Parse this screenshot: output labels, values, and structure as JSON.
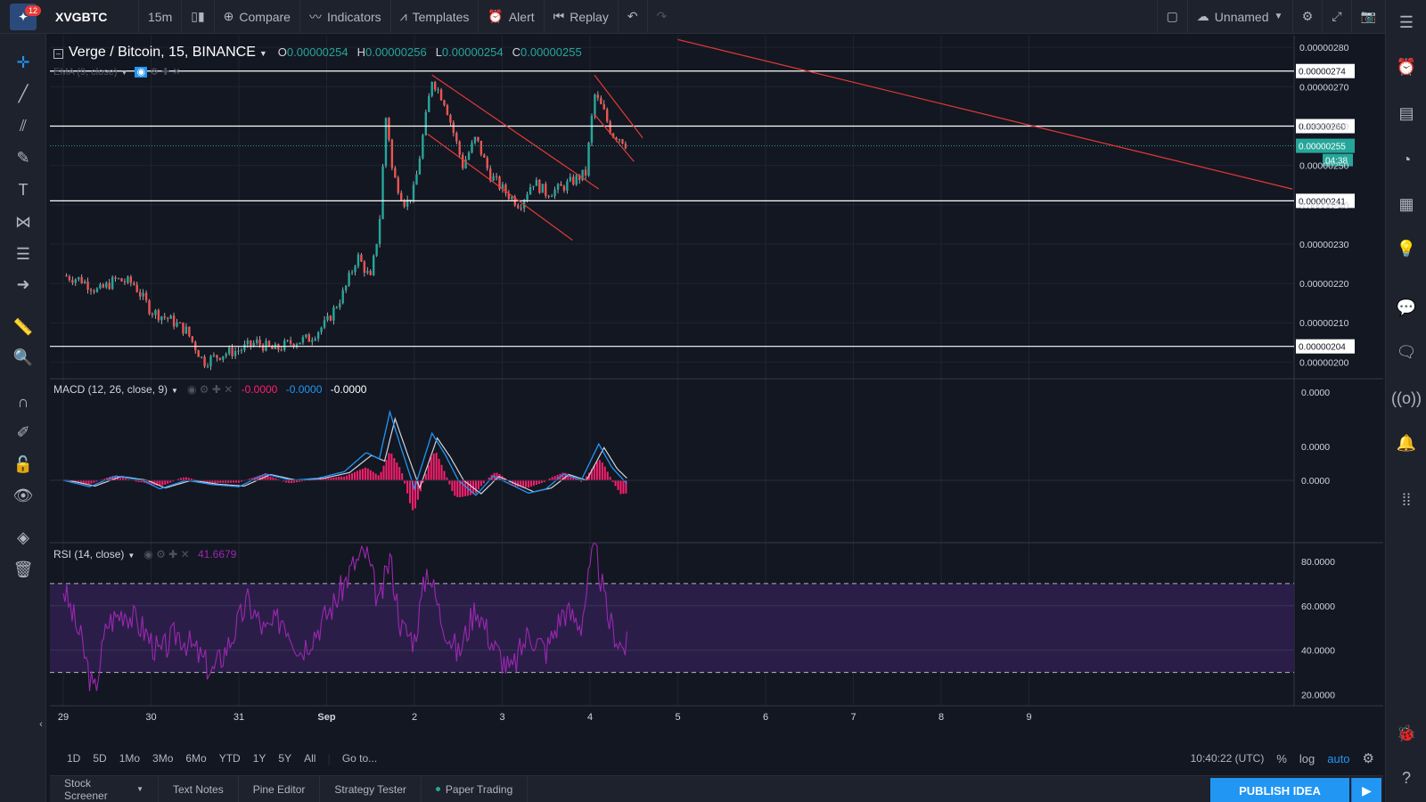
{
  "topbar": {
    "notification_count": "12",
    "symbol": "XVGBTC",
    "interval": "15m",
    "compare_label": "Compare",
    "indicators_label": "Indicators",
    "templates_label": "Templates",
    "alert_label": "Alert",
    "replay_label": "Replay",
    "layout_name": "Unnamed"
  },
  "legend": {
    "title": "Verge / Bitcoin, 15, BINANCE",
    "o_label": "O",
    "o_value": "0.00000254",
    "h_label": "H",
    "h_value": "0.00000256",
    "l_label": "L",
    "l_value": "0.00000254",
    "c_label": "C",
    "c_value": "0.00000255",
    "ema_label": "EMA (9, close)",
    "macd_label": "MACD (12, 26, close, 9)",
    "macd_v1": "-0.0000",
    "macd_v2": "-0.0000",
    "macd_v3": "-0.0000",
    "rsi_label": "RSI (14, close)",
    "rsi_value": "41.6679"
  },
  "chart_data": {
    "type": "candlestick",
    "symbol": "XVGBTC",
    "x_ticks": [
      "29",
      "30",
      "31",
      "Sep",
      "2",
      "3",
      "4",
      "5",
      "6",
      "7",
      "8",
      "9"
    ],
    "price_axis": [
      "0.00000280",
      "0.00000270",
      "0.00000260",
      "0.00000250",
      "0.00000240",
      "0.00000230",
      "0.00000220",
      "0.00000210",
      "0.00000200"
    ],
    "ylim": [
      1.96e-06,
      2.83e-06
    ],
    "horizontal_levels": [
      {
        "label": "0.00000274",
        "value": 2.74e-06
      },
      {
        "label": "0.00000260",
        "value": 2.6e-06
      },
      {
        "label": "0.00000241",
        "value": 2.41e-06
      },
      {
        "label": "0.00000204",
        "value": 2.04e-06
      }
    ],
    "last_price": {
      "label": "0.00000255",
      "value": 2.55e-06,
      "countdown": "04:38"
    },
    "close_path": [
      [
        0,
        2.22e-06
      ],
      [
        0.2,
        2.21e-06
      ],
      [
        0.4,
        2.18e-06
      ],
      [
        0.6,
        2.21e-06
      ],
      [
        0.8,
        2.2e-06
      ],
      [
        1.0,
        2.13e-06
      ],
      [
        1.2,
        2.11e-06
      ],
      [
        1.4,
        2.08e-06
      ],
      [
        1.6,
        2e-06
      ],
      [
        1.8,
        2.02e-06
      ],
      [
        2.0,
        2.03e-06
      ],
      [
        2.2,
        2.05e-06
      ],
      [
        2.4,
        2.03e-06
      ],
      [
        2.6,
        2.05e-06
      ],
      [
        2.8,
        2.06e-06
      ],
      [
        3.0,
        2.1e-06
      ],
      [
        3.2,
        2.18e-06
      ],
      [
        3.35,
        2.27e-06
      ],
      [
        3.5,
        2.21e-06
      ],
      [
        3.6,
        2.35e-06
      ],
      [
        3.68,
        2.64e-06
      ],
      [
        3.75,
        2.48e-06
      ],
      [
        3.9,
        2.4e-06
      ],
      [
        4.0,
        2.44e-06
      ],
      [
        4.1,
        2.58e-06
      ],
      [
        4.2,
        2.72e-06
      ],
      [
        4.35,
        2.66e-06
      ],
      [
        4.45,
        2.58e-06
      ],
      [
        4.55,
        2.5e-06
      ],
      [
        4.7,
        2.57e-06
      ],
      [
        4.85,
        2.48e-06
      ],
      [
        5.0,
        2.44e-06
      ],
      [
        5.2,
        2.4e-06
      ],
      [
        5.35,
        2.46e-06
      ],
      [
        5.5,
        2.43e-06
      ],
      [
        5.65,
        2.44e-06
      ],
      [
        5.8,
        2.46e-06
      ],
      [
        5.95,
        2.48e-06
      ],
      [
        6.05,
        2.68e-06
      ],
      [
        6.15,
        2.64e-06
      ],
      [
        6.25,
        2.58e-06
      ],
      [
        6.35,
        2.57e-06
      ],
      [
        6.43,
        2.55e-06
      ]
    ],
    "trendlines": [
      {
        "from": [
          4.15,
          2.58e-06
        ],
        "to": [
          5.8,
          2.31e-06
        ]
      },
      {
        "from": [
          4.2,
          2.73e-06
        ],
        "to": [
          6.1,
          2.44e-06
        ]
      },
      {
        "from": [
          6.05,
          2.73e-06
        ],
        "to": [
          6.6,
          2.57e-06
        ]
      },
      {
        "from": [
          6.05,
          2.63e-06
        ],
        "to": [
          6.5,
          2.51e-06
        ]
      },
      {
        "from": [
          7.0,
          2.82e-06
        ],
        "to": [
          14.0,
          2.44e-06
        ]
      }
    ],
    "macd_axis": [
      "0.0000",
      "0.0000",
      "0.0000"
    ],
    "macd_series": [
      [
        0,
        0.0
      ],
      [
        0.3,
        -0.3
      ],
      [
        0.6,
        0.2
      ],
      [
        0.9,
        0.0
      ],
      [
        1.1,
        -0.4
      ],
      [
        1.4,
        0.0
      ],
      [
        1.7,
        -0.2
      ],
      [
        2.0,
        -0.3
      ],
      [
        2.3,
        0.3
      ],
      [
        2.6,
        0.0
      ],
      [
        2.9,
        0.1
      ],
      [
        3.2,
        0.4
      ],
      [
        3.45,
        1.3
      ],
      [
        3.6,
        1.0
      ],
      [
        3.72,
        3.2
      ],
      [
        3.85,
        1.5
      ],
      [
        4.0,
        -0.4
      ],
      [
        4.2,
        2.2
      ],
      [
        4.35,
        1.2
      ],
      [
        4.5,
        0.0
      ],
      [
        4.7,
        -0.7
      ],
      [
        4.9,
        0.2
      ],
      [
        5.1,
        -0.2
      ],
      [
        5.3,
        -0.6
      ],
      [
        5.5,
        -0.4
      ],
      [
        5.7,
        0.3
      ],
      [
        5.9,
        0.0
      ],
      [
        6.1,
        1.7
      ],
      [
        6.25,
        0.6
      ],
      [
        6.43,
        -0.2
      ]
    ],
    "rsi_axis": [
      "80.0000",
      "60.0000",
      "40.0000",
      "20.0000"
    ],
    "rsi_bands": [
      30,
      70
    ],
    "rsi_ylim": [
      15,
      88
    ],
    "rsi_series": [
      [
        0,
        68
      ],
      [
        0.2,
        45
      ],
      [
        0.35,
        20
      ],
      [
        0.5,
        52
      ],
      [
        0.7,
        58
      ],
      [
        0.9,
        50
      ],
      [
        1.1,
        38
      ],
      [
        1.3,
        48
      ],
      [
        1.5,
        40
      ],
      [
        1.7,
        30
      ],
      [
        1.9,
        44
      ],
      [
        2.1,
        62
      ],
      [
        2.3,
        48
      ],
      [
        2.5,
        55
      ],
      [
        2.7,
        40
      ],
      [
        2.9,
        50
      ],
      [
        3.1,
        62
      ],
      [
        3.3,
        78
      ],
      [
        3.45,
        84
      ],
      [
        3.6,
        60
      ],
      [
        3.72,
        82
      ],
      [
        3.85,
        50
      ],
      [
        4.0,
        45
      ],
      [
        4.15,
        78
      ],
      [
        4.3,
        55
      ],
      [
        4.5,
        38
      ],
      [
        4.7,
        60
      ],
      [
        4.9,
        42
      ],
      [
        5.1,
        30
      ],
      [
        5.3,
        48
      ],
      [
        5.5,
        40
      ],
      [
        5.7,
        58
      ],
      [
        5.9,
        52
      ],
      [
        6.05,
        88
      ],
      [
        6.2,
        55
      ],
      [
        6.35,
        42
      ],
      [
        6.43,
        41.67
      ]
    ]
  },
  "range": {
    "buttons": [
      "1D",
      "5D",
      "1Mo",
      "3Mo",
      "6Mo",
      "YTD",
      "1Y",
      "5Y",
      "All"
    ],
    "goto_label": "Go to...",
    "time": "10:40:22 (UTC)",
    "percent_label": "%",
    "log_label": "log",
    "auto_label": "auto"
  },
  "bottom": {
    "tabs": [
      "Stock Screener",
      "Text Notes",
      "Pine Editor",
      "Strategy Tester",
      "Paper Trading"
    ],
    "publish_label": "PUBLISH IDEA"
  },
  "colors": {
    "background": "#131722",
    "candle_up": "#26a69a",
    "candle_down": "#ef5350",
    "trendline": "#e53935",
    "macd_line": "#2196f3",
    "signal_line": "#d1d4dc",
    "histogram": "#ff1e6e",
    "rsi_line": "#9c27b0",
    "rsi_band": "#2a1e48",
    "accent": "#2196f3"
  }
}
